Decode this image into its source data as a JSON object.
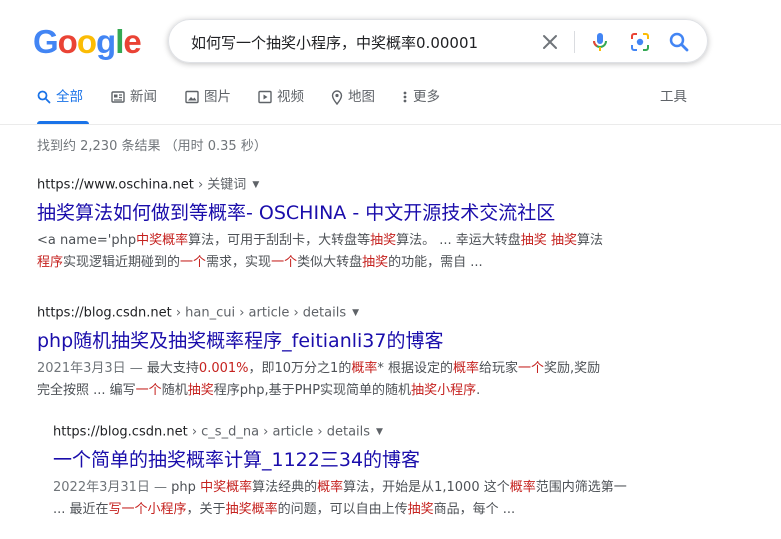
{
  "logo": {
    "letters": [
      "G",
      "o",
      "o",
      "g",
      "l",
      "e"
    ],
    "colors": [
      "#4285f4",
      "#ea4335",
      "#fbbc05",
      "#4285f4",
      "#34a853",
      "#ea4335"
    ]
  },
  "search": {
    "value": "如何写一个抽奖小程序，中奖概率0.00001"
  },
  "tabs": [
    {
      "label": "全部",
      "icon": "search-icon",
      "active": true
    },
    {
      "label": "新闻",
      "icon": "news-icon"
    },
    {
      "label": "图片",
      "icon": "image-icon"
    },
    {
      "label": "视频",
      "icon": "video-icon"
    },
    {
      "label": "地图",
      "icon": "map-pin-icon"
    },
    {
      "label": "更多",
      "icon": "more-vert-icon"
    }
  ],
  "tools_label": "工具",
  "stats": "找到约 2,230 条结果 （用时 0.35 秒）",
  "results": [
    {
      "site": "https://www.oschina.net",
      "path": " › 关键词",
      "title": "抽奖算法如何做到等概率- OSCHINA - 中文开源技术交流社区",
      "snippet_lines": [
        [
          {
            "t": "<a name='php"
          },
          {
            "t": "中奖概率",
            "em": true
          },
          {
            "t": "算法，可用于刮刮卡，大转盘等"
          },
          {
            "t": "抽奖",
            "em": true
          },
          {
            "t": "算法。 ... 幸运大转盘"
          },
          {
            "t": "抽奖",
            "em": true
          },
          {
            "t": " "
          },
          {
            "t": "抽奖",
            "em": true
          },
          {
            "t": "算法"
          }
        ],
        [
          {
            "t": "程序",
            "em": true
          },
          {
            "t": "实现逻辑近期碰到的"
          },
          {
            "t": "一个",
            "em": true
          },
          {
            "t": "需求，实现"
          },
          {
            "t": "一个",
            "em": true
          },
          {
            "t": "类似大转盘"
          },
          {
            "t": "抽奖",
            "em": true
          },
          {
            "t": "的功能，需自 ..."
          }
        ]
      ]
    },
    {
      "site": "https://blog.csdn.net",
      "path": " › han_cui › article › details",
      "title": "php随机抽奖及抽奖概率程序_feitianli37的博客",
      "snippet_lines": [
        [
          {
            "t": "2021年3月3日 — ",
            "date": true
          },
          {
            "t": "最大支持"
          },
          {
            "t": "0.001%",
            "em": true
          },
          {
            "t": "，即10万分之1的"
          },
          {
            "t": "概率",
            "em": true
          },
          {
            "t": "* 根据设定的"
          },
          {
            "t": "概率",
            "em": true
          },
          {
            "t": "给玩家"
          },
          {
            "t": "一个",
            "em": true
          },
          {
            "t": "奖励,奖励"
          }
        ],
        [
          {
            "t": "完全按照 ... 编写"
          },
          {
            "t": "一个",
            "em": true
          },
          {
            "t": "随机"
          },
          {
            "t": "抽奖",
            "em": true
          },
          {
            "t": "程序php,基于PHP实现简单的随机"
          },
          {
            "t": "抽奖小程序",
            "em": true
          },
          {
            "t": "."
          }
        ]
      ]
    },
    {
      "site": "https://blog.csdn.net",
      "path": " › c_s_d_na › article › details",
      "title": "一个简单的抽奖概率计算_1122三34的博客",
      "snippet_lines": [
        [
          {
            "t": "2022年3月31日 — ",
            "date": true
          },
          {
            "t": "php "
          },
          {
            "t": "中奖概率",
            "em": true
          },
          {
            "t": "算法经典的"
          },
          {
            "t": "概率",
            "em": true
          },
          {
            "t": "算法，开始是从1,1000 这个"
          },
          {
            "t": "概率",
            "em": true
          },
          {
            "t": "范围内筛选第一"
          }
        ],
        [
          {
            "t": "... 最近在"
          },
          {
            "t": "写一个小程序",
            "em": true
          },
          {
            "t": "，关于"
          },
          {
            "t": "抽奖概率",
            "em": true
          },
          {
            "t": "的问题，可以自由上传"
          },
          {
            "t": "抽奖",
            "em": true
          },
          {
            "t": "商品，每个 ..."
          }
        ]
      ]
    }
  ]
}
